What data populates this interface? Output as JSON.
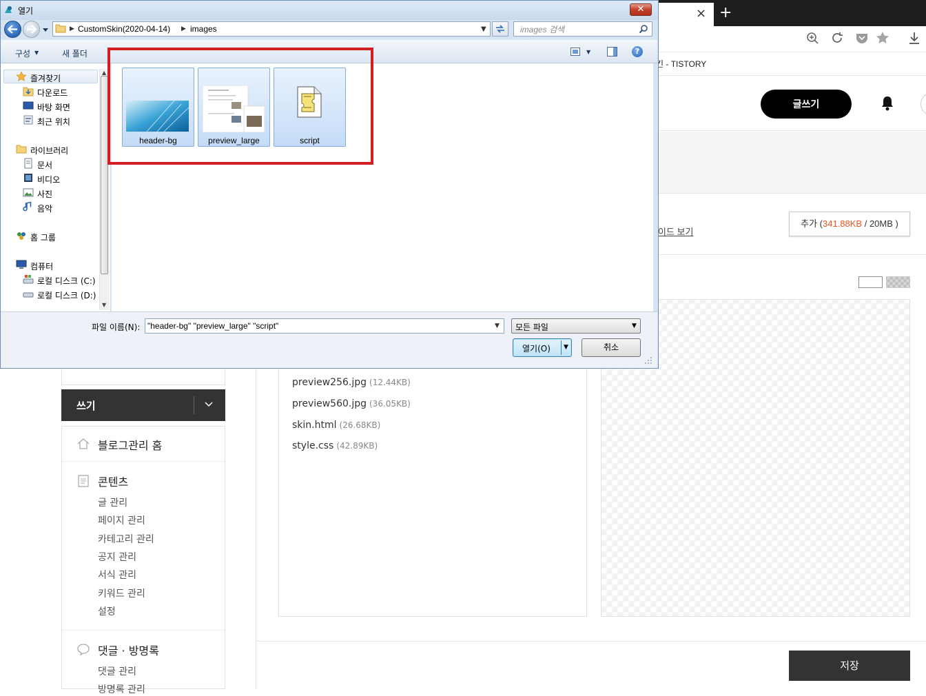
{
  "browser": {
    "tab_close": "×",
    "new_tab": "+",
    "bookmark_text": "킨 - TISTORY"
  },
  "tistory": {
    "write_button": "글쓰기",
    "guide_link": "이드 보기",
    "storage": {
      "prefix": "추가 (",
      "used": "341.88KB",
      "sep": " / ",
      "total": "20MB",
      "suffix": " )"
    },
    "files": [
      {
        "name": "preview256.jpg",
        "size": "(12.44KB)"
      },
      {
        "name": "preview560.jpg",
        "size": "(36.05KB)"
      },
      {
        "name": "skin.html",
        "size": "(26.68KB)"
      },
      {
        "name": "style.css",
        "size": "(42.89KB)"
      }
    ],
    "save_button": "저장",
    "sidebar": {
      "write": "쓰기",
      "home": "블로그관리 홈",
      "contents_title": "콘텐츠",
      "contents_items": [
        "글 관리",
        "페이지 관리",
        "카테고리 관리",
        "공지 관리",
        "서식 관리",
        "키워드 관리",
        "설정"
      ],
      "comments_title": "댓글 · 방명록",
      "comments_items": [
        "댓글 관리",
        "방명록 관리"
      ]
    }
  },
  "dialog": {
    "title": "열기",
    "close": "✕",
    "address": {
      "crumbs": [
        "CustomSkin(2020-04-14)",
        "images"
      ]
    },
    "search_placeholder": "images 검색",
    "commands": {
      "organize": "구성",
      "new_folder": "새 폴더",
      "help": "?"
    },
    "nav": {
      "favorites": "즐겨찾기",
      "downloads": "다운로드",
      "desktop": "바탕 화면",
      "recent": "최근 위치",
      "libraries": "라이브러리",
      "documents": "문서",
      "videos": "비디오",
      "pictures": "사진",
      "music": "음악",
      "homegroup": "홈 그룹",
      "computer": "컴퓨터",
      "drive_c": "로컬 디스크 (C:)",
      "drive_d": "로컬 디스크 (D:)"
    },
    "items": [
      {
        "name": "header-bg"
      },
      {
        "name": "preview_large"
      },
      {
        "name": "script"
      }
    ],
    "filename_label": "파일 이름(N):",
    "filename_value": "\"header-bg\" \"preview_large\" \"script\"",
    "filetype": "모든 파일",
    "open_button": "열기(O)",
    "cancel_button": "취소"
  },
  "colors": {
    "highlight_rect": "#d21e22",
    "storage_used": "#eb531f",
    "save_button_bg": "#333333"
  }
}
